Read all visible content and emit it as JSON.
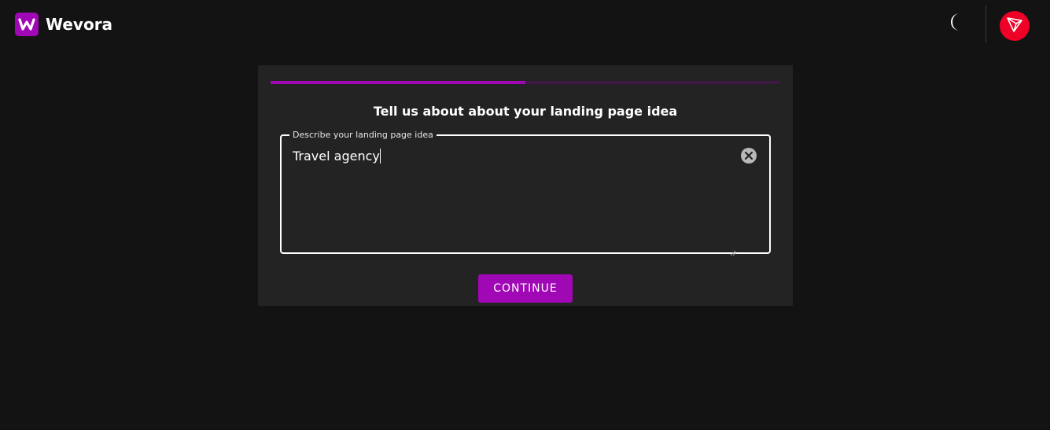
{
  "app": {
    "brand_name": "Wevora",
    "brand_color": "#a007b5"
  },
  "header": {
    "logo_icon": "w-logo-icon",
    "theme_icon": "moon-icon",
    "avatar_icon": "tron-icon",
    "avatar_color": "#ef0027"
  },
  "wizard": {
    "progress": 0.5,
    "title": "Tell us about about your landing page idea",
    "field": {
      "label": "Describe your landing page idea",
      "value": "Travel agency",
      "clear_icon": "clear-circle-icon"
    },
    "continue_label": "CONTINUE"
  }
}
